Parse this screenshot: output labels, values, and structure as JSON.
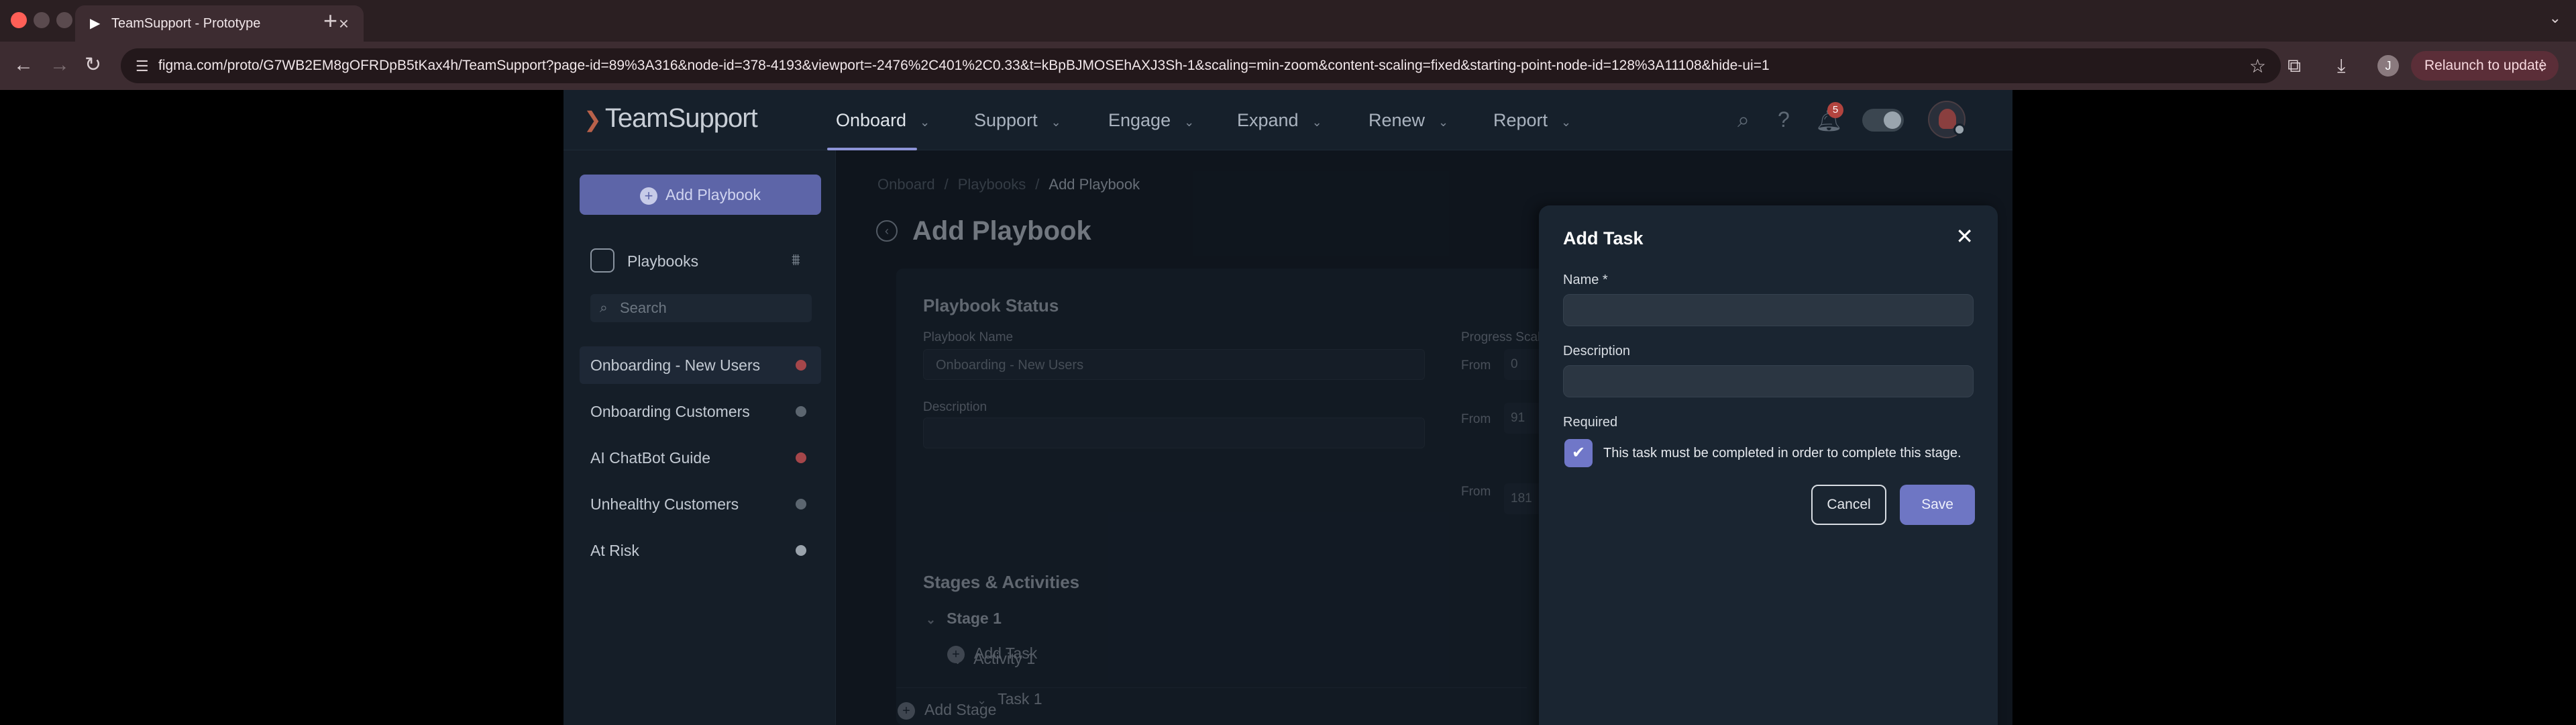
{
  "browser": {
    "tab_title": "TeamSupport - Prototype",
    "url": "figma.com/proto/G7WB2EM8gOFRDpB5tKax4h/TeamSupport?page-id=89%3A316&node-id=378-4193&viewport=-2476%2C401%2C0.33&t=kBpBJMOSEhAXJ3Sh-1&scaling=min-zoom&content-scaling=fixed&starting-point-node-id=128%3A11108&hide-ui=1",
    "profile_initial": "J",
    "relaunch_label": "Relaunch to update"
  },
  "app": {
    "logo": "TeamSupport",
    "nav": [
      "Onboard",
      "Support",
      "Engage",
      "Expand",
      "Renew",
      "Report"
    ],
    "notification_count": "5"
  },
  "sidebar": {
    "add_button": "Add Playbook",
    "header": "Playbooks",
    "search_placeholder": "Search",
    "items": [
      {
        "label": "Onboarding - New Users",
        "dot_color": "#a5464a"
      },
      {
        "label": "Onboarding Customers",
        "dot_color": "#5c6670"
      },
      {
        "label": "AI ChatBot Guide",
        "dot_color": "#a5464a"
      },
      {
        "label": "Unhealthy Customers",
        "dot_color": "#5c6670"
      },
      {
        "label": "At Risk",
        "dot_color": "#9aa3ac"
      }
    ]
  },
  "main": {
    "breadcrumb": [
      "Onboard",
      "Playbooks",
      "Add Playbook"
    ],
    "title": "Add Playbook",
    "status_section": "Playbook Status",
    "playbook_name_label": "Playbook Name",
    "playbook_name_value": "Onboarding - New Users",
    "description_label": "Description",
    "progress_label": "Progress Scale",
    "from_label": "From",
    "from_values": [
      "0",
      "91",
      "181"
    ],
    "stages_section": "Stages & Activities",
    "stage": "Stage 1",
    "activity": "Activity 1",
    "task": "Task 1",
    "add_task": "Add Task",
    "add_stage": "Add Stage"
  },
  "drawer": {
    "title": "Add Task",
    "name_label": "Name *",
    "name_value": "",
    "description_label": "Description",
    "description_value": "",
    "required_label": "Required",
    "required_text": "This task must be completed in order to complete this stage.",
    "cancel": "Cancel",
    "save": "Save"
  },
  "colors": {
    "accent": "#6e76c4",
    "background": "#131b24"
  }
}
